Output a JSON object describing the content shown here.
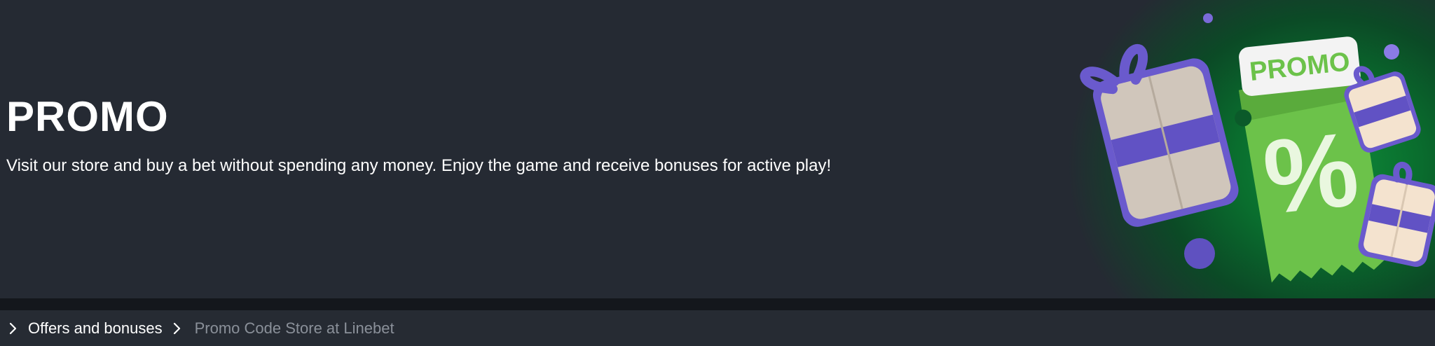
{
  "hero": {
    "title": "PROMO",
    "description": "Visit our store and buy a bet without spending any money. Enjoy the game and receive bonuses for active play!",
    "ticket_label": "PROMO",
    "ticket_symbol": "%"
  },
  "breadcrumb": {
    "items": [
      {
        "label": "Offers and bonuses",
        "icon": "chevron-right-icon"
      },
      {
        "label": "Promo Code Store at Linebet",
        "icon": "chevron-right-icon"
      }
    ]
  },
  "colors": {
    "background": "#252a33",
    "divider": "#14171c",
    "breadcrumb_bg": "#262b33",
    "text_primary": "#ffffff",
    "text_muted": "#8a9099",
    "ticket_green": "#6cc24a",
    "gift_purple": "#6a5acd"
  }
}
